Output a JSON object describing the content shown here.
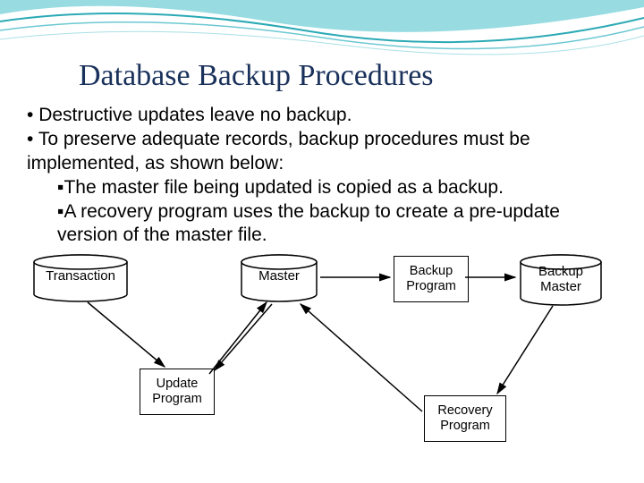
{
  "title": "Database Backup Procedures",
  "bullets": [
    "Destructive updates leave no backup.",
    "To preserve adequate records, backup procedures must be implemented, as shown below:"
  ],
  "subbullets": [
    "The master file being updated is copied as a backup.",
    "A recovery program uses the backup to create a pre-update version of the master file."
  ],
  "diagram": {
    "nodes": {
      "transaction": "Transaction",
      "update_program": "Update\nProgram",
      "master": "Master",
      "backup_program": "Backup\nProgram",
      "backup_master": "Backup\nMaster",
      "recovery_program": "Recovery\nProgram"
    }
  },
  "chart_data": {
    "type": "diagram",
    "title": "Database Backup Procedures",
    "nodes": [
      {
        "id": "transaction",
        "label": "Transaction",
        "shape": "cylinder"
      },
      {
        "id": "update_program",
        "label": "Update Program",
        "shape": "rect"
      },
      {
        "id": "master",
        "label": "Master",
        "shape": "cylinder"
      },
      {
        "id": "backup_program",
        "label": "Backup Program",
        "shape": "rect"
      },
      {
        "id": "backup_master",
        "label": "Backup Master",
        "shape": "cylinder"
      },
      {
        "id": "recovery_program",
        "label": "Recovery Program",
        "shape": "rect"
      }
    ],
    "edges": [
      {
        "from": "transaction",
        "to": "update_program"
      },
      {
        "from": "update_program",
        "to": "master",
        "bidirectional": true
      },
      {
        "from": "master",
        "to": "backup_program"
      },
      {
        "from": "backup_program",
        "to": "backup_master"
      },
      {
        "from": "backup_master",
        "to": "recovery_program"
      },
      {
        "from": "recovery_program",
        "to": "master"
      }
    ]
  }
}
